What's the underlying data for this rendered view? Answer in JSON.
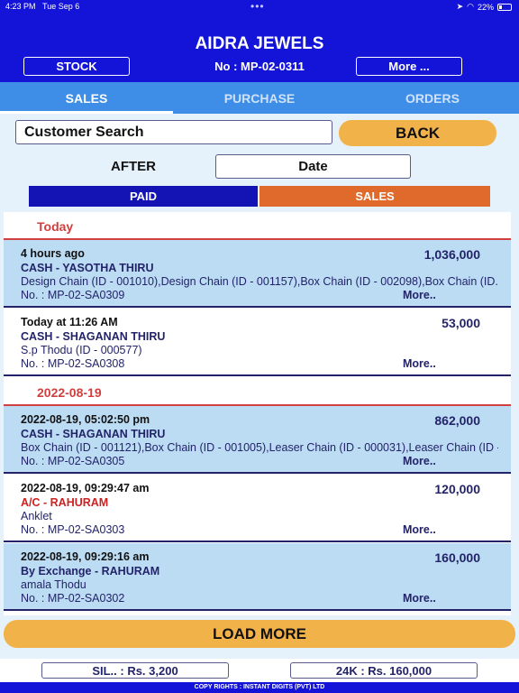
{
  "status_bar": {
    "time": "4:23 PM",
    "date": "Tue Sep 6",
    "battery": "22%"
  },
  "header": {
    "title": "AIDRA JEWELS",
    "stock_label": "STOCK",
    "order_no": "No : MP-02-0311",
    "more_label": "More ..."
  },
  "tabs": [
    {
      "label": "SALES",
      "active": true
    },
    {
      "label": "PURCHASE",
      "active": false
    },
    {
      "label": "ORDERS",
      "active": false
    }
  ],
  "search": {
    "value": "Customer Search",
    "back_label": "BACK"
  },
  "filter": {
    "after_label": "AFTER",
    "date_value": "Date"
  },
  "segments": {
    "paid": "PAID",
    "sales": "SALES"
  },
  "sections": [
    {
      "label": "Today"
    },
    {
      "label": "2022-08-19"
    }
  ],
  "records": [
    {
      "time": "4 hours ago",
      "amount": "1,036,000",
      "customer": "CASH - YASOTHA THIRU",
      "items": "Design Chain (ID - 001010),Design Chain (ID - 001157),Box Chain (ID - 002098),Box Chain (ID...",
      "no": "No. : MP-02-SA0309",
      "more": "More.."
    },
    {
      "time": "Today at 11:26 AM",
      "amount": "53,000",
      "customer": "CASH - SHAGANAN THIRU",
      "items": "S.p Thodu (ID - 000577)",
      "no": "No. : MP-02-SA0308",
      "more": "More.."
    },
    {
      "time": "2022-08-19, 05:02:50 pm",
      "amount": "862,000",
      "customer": "CASH - SHAGANAN THIRU",
      "items": "Box Chain (ID - 001121),Box Chain (ID - 001005),Leaser Chain (ID - 000031),Leaser Chain (ID -...",
      "no": "No. : MP-02-SA0305",
      "more": "More.."
    },
    {
      "time": "2022-08-19, 09:29:47 am",
      "amount": "120,000",
      "customer": "A/C - RAHURAM",
      "items": "Anklet",
      "no": "No. : MP-02-SA0303",
      "more": "More.."
    },
    {
      "time": "2022-08-19, 09:29:16 am",
      "amount": "160,000",
      "customer": "By Exchange - RAHURAM",
      "items": "amala Thodu",
      "no": "No. : MP-02-SA0302",
      "more": "More.."
    }
  ],
  "load_more": "LOAD MORE",
  "totals": {
    "sil": "SIL.. : Rs. 3,200",
    "k24": "24K : Rs. 160,000"
  },
  "footer": "COPY RIGHTS : INSTANT DIGITS (PVT) LTD",
  "colors": {
    "primary": "#1414d8",
    "accent": "#f2b24a",
    "sales_orange": "#e06a2c",
    "row_blue": "#bcdcf4",
    "section_red": "#d04040"
  }
}
